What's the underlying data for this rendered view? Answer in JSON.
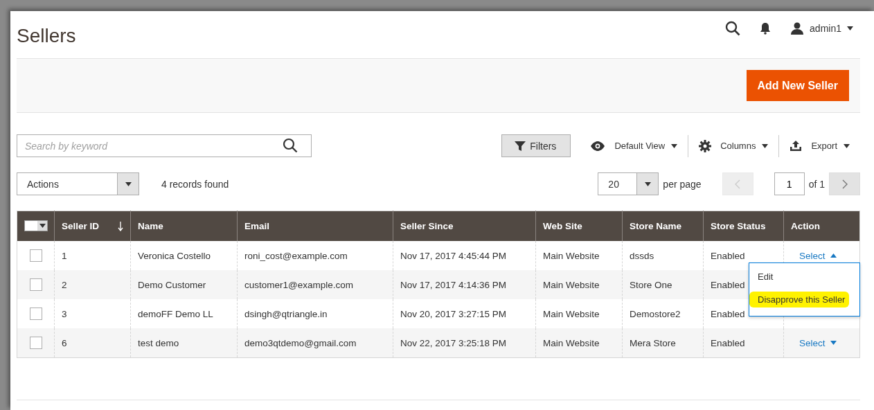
{
  "page": {
    "title": "Sellers"
  },
  "header": {
    "user": "admin1"
  },
  "toolbar": {
    "primary_button": "Add New Seller"
  },
  "search": {
    "placeholder": "Search by keyword"
  },
  "view_controls": [
    {
      "kind": "filters",
      "label": "Filters"
    },
    {
      "kind": "view",
      "label": "Default View"
    },
    {
      "kind": "columns",
      "label": "Columns"
    },
    {
      "kind": "export",
      "label": "Export"
    }
  ],
  "actions": {
    "value": "Actions"
  },
  "records_found": "4 records found",
  "pagination": {
    "per_page_value": "20",
    "per_page_label": "per page",
    "page": "1",
    "of_label": "of 1",
    "prev_disabled": true,
    "next_disabled": false
  },
  "table": {
    "mass_select": {
      "checked": false
    },
    "columns": [
      {
        "label": "Seller ID",
        "sorted": true
      },
      {
        "label": "Name",
        "sorted": false
      },
      {
        "label": "Email",
        "sorted": false
      },
      {
        "label": "Seller Since",
        "sorted": false
      },
      {
        "label": "Web Site",
        "sorted": false
      },
      {
        "label": "Store Name",
        "sorted": false
      },
      {
        "label": "Store Status",
        "sorted": false
      },
      {
        "label": "Action",
        "sorted": false
      }
    ],
    "rows": [
      {
        "checked": false,
        "cells": [
          "1",
          "Veronica Costello",
          "roni_cost@example.com",
          "Nov 17, 2017 4:45:44 PM",
          "Main Website",
          "dssds",
          "Enabled"
        ],
        "action": {
          "label": "Select",
          "expanded": true
        }
      },
      {
        "checked": false,
        "cells": [
          "2",
          "Demo Customer",
          "customer1@example.com",
          "Nov 17, 2017 4:14:36 PM",
          "Main Website",
          "Store One",
          "Enabled"
        ]
      },
      {
        "checked": false,
        "cells": [
          "3",
          "demoFF Demo LL",
          "dsingh@qtriangle.in",
          "Nov 20, 2017 3:27:15 PM",
          "Main Website",
          "Demostore2",
          "Enabled"
        ]
      },
      {
        "checked": false,
        "cells": [
          "6",
          "test demo",
          "demo3qtdemo@gmail.com",
          "Nov 22, 2017 3:25:18 PM",
          "Main Website",
          "Mera Store",
          "Enabled"
        ],
        "action": {
          "label": "Select",
          "expanded": false
        }
      }
    ]
  },
  "action_menu": [
    {
      "label": "Edit",
      "highlighted": false
    },
    {
      "label": "Disapprove this Seller",
      "highlighted": true
    }
  ]
}
